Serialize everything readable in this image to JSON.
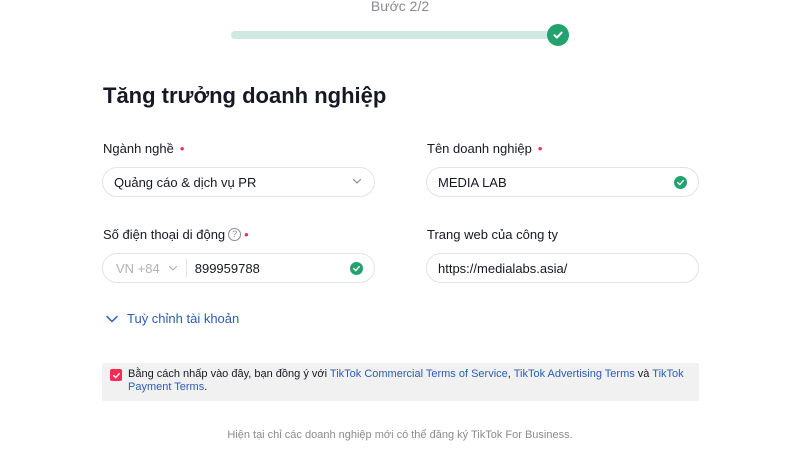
{
  "progress": {
    "step_label": "Bước 2/2",
    "percent_complete": 100
  },
  "form": {
    "title": "Tăng trưởng doanh nghiệp",
    "industry": {
      "label": "Ngành nghề",
      "required_mark": "•",
      "value": "Quảng cáo & dịch vụ PR"
    },
    "business_name": {
      "label": "Tên doanh nghiệp",
      "required_mark": "•",
      "value": "MEDIA LAB"
    },
    "phone": {
      "label": "Số điện thoại di động",
      "help_glyph": "?",
      "required_mark": "•",
      "country_code": "VN +84",
      "value": "899959788"
    },
    "website": {
      "label": "Trang web của công ty",
      "value": "https://medialabs.asia/"
    },
    "customize_label": "Tuỳ chỉnh tài khoản"
  },
  "consent": {
    "checked": true,
    "text_before": "Bằng cách nhấp vào đây, bạn đồng ý với ",
    "link_commercial": "TikTok Commercial Terms of Service",
    "sep1": ", ",
    "link_advertising": "TikTok Advertising Terms",
    "sep2": " và ",
    "link_payment": "TikTok Payment Terms",
    "text_after": "."
  },
  "footer": {
    "note": "Hiện tại chỉ các doanh nghiệp mới có thể đăng ký TikTok For Business."
  },
  "colors": {
    "accent_green": "#23a26d",
    "progress_track": "#cfe8e2",
    "required_red": "#fe2c55",
    "link_blue": "#2b5db5"
  },
  "icons": {
    "step_complete": "check-circle-icon",
    "field_valid": "check-circle-icon",
    "dropdown": "chevron-down-icon",
    "help": "question-circle-icon",
    "checkbox": "checkbox-checked-icon"
  }
}
